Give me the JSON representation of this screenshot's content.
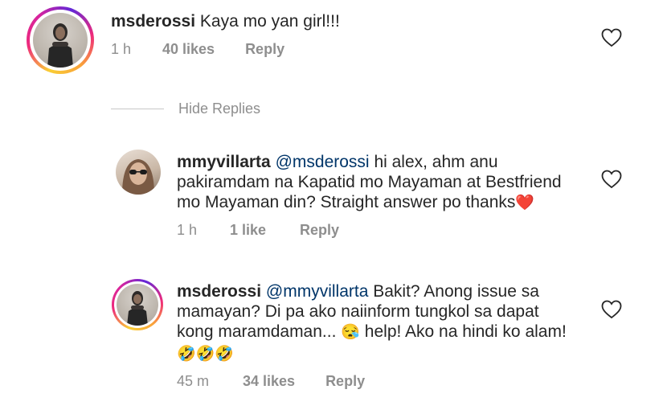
{
  "comments": [
    {
      "username": "msderossi",
      "text": "Kaya mo yan girl!!!",
      "time": "1 h",
      "likes": "40 likes",
      "reply": "Reply"
    }
  ],
  "hide_replies": "Hide Replies",
  "replies": [
    {
      "username": "mmyvillarta",
      "mention": "@msderossi",
      "lines": [
        "hi alex, ahm anu",
        "pakiramdam na Kapatid mo Mayaman at Bestfriend",
        "mo Mayaman din? Straight answer po thanks"
      ],
      "emoji_end": "❤️",
      "time": "1 h",
      "likes": "1 like",
      "reply": "Reply"
    },
    {
      "username": "msderossi",
      "mention": "@mmyvillarta",
      "lines": [
        "Bakit? Anong issue sa",
        "mamayan? Di pa ako naiinform tungkol sa dapat",
        "kong maramdaman...",
        "help! Ako na hindi ko alam!"
      ],
      "emoji_mid": "😪",
      "emoji_line": "🤣🤣🤣",
      "time": "45 m",
      "likes": "34 likes",
      "reply": "Reply"
    }
  ],
  "icons": {
    "heart": "heart-outline-icon"
  },
  "colors": {
    "text": "#262626",
    "muted": "#8e8e8e",
    "mention": "#003569",
    "divider": "#c7c7c7",
    "heart_stroke": "#262626"
  }
}
